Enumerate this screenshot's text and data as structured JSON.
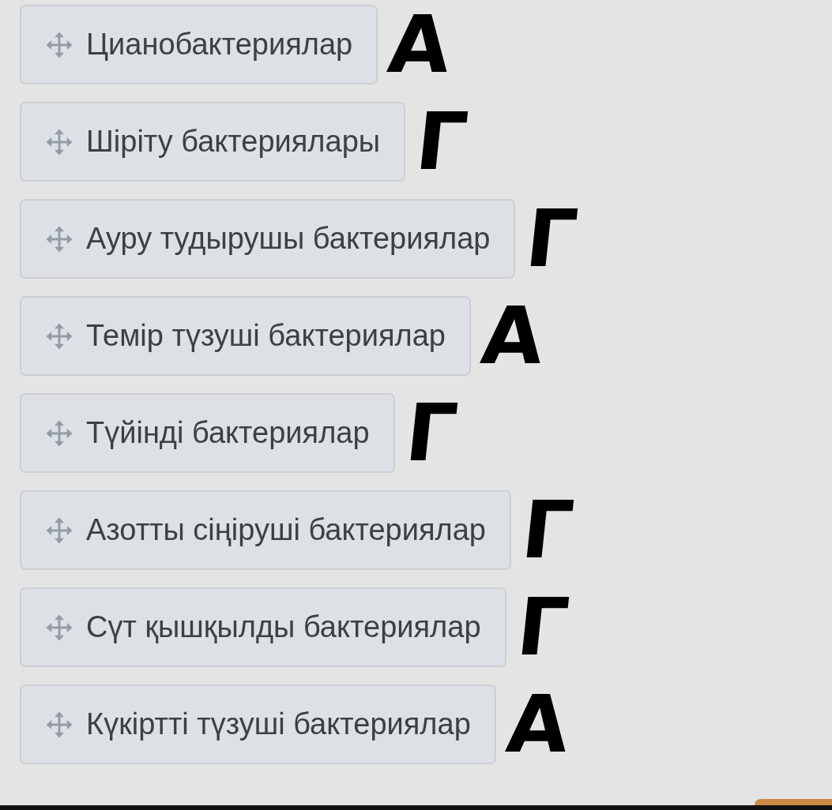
{
  "items": [
    {
      "label": "Цианобактериялар",
      "mark": "А"
    },
    {
      "label": "Шіріту бактериялары",
      "mark": "Г"
    },
    {
      "label": "Ауру тудырушы бактериялар",
      "mark": "Г"
    },
    {
      "label": "Темір түзуші бактериялар",
      "mark": "А"
    },
    {
      "label": "Түйінді бактериялар",
      "mark": "Г"
    },
    {
      "label": "Азотты сіңіруші бактериялар",
      "mark": "Г"
    },
    {
      "label": "Сүт қышқылды бактериялар",
      "mark": "Г"
    },
    {
      "label": "Күкіртті түзуші бактериялар",
      "mark": "А"
    }
  ]
}
